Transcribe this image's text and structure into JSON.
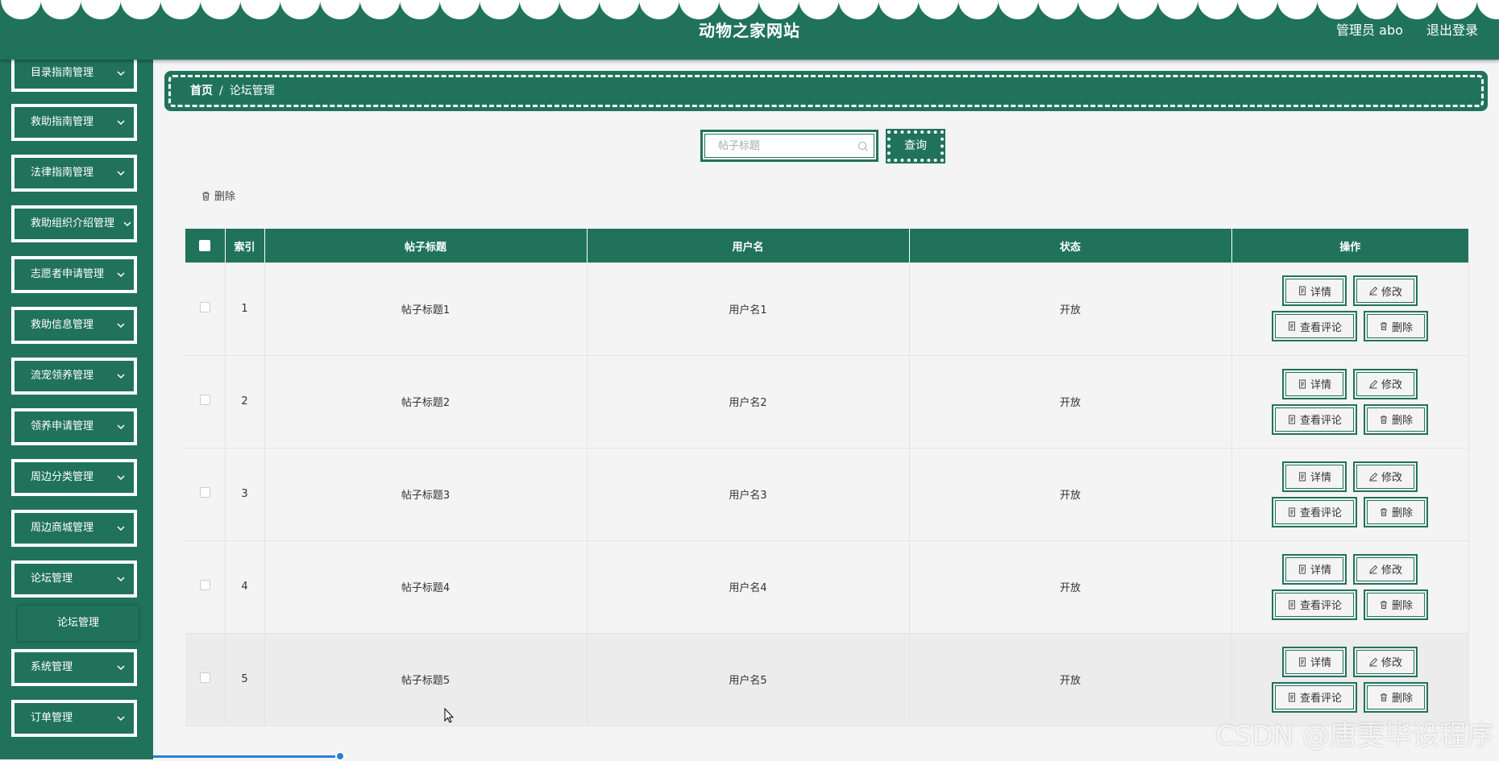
{
  "header": {
    "site_title": "动物之家网站",
    "admin_label": "管理员 abo",
    "logout_label": "退出登录"
  },
  "sidebar": {
    "items": [
      {
        "label": "目录指南管理"
      },
      {
        "label": "救助指南管理"
      },
      {
        "label": "法律指南管理"
      },
      {
        "label": "救助组织介绍管理"
      },
      {
        "label": "志愿者申请管理"
      },
      {
        "label": "救助信息管理"
      },
      {
        "label": "流宠领养管理"
      },
      {
        "label": "领养申请管理"
      },
      {
        "label": "周边分类管理"
      },
      {
        "label": "周边商城管理"
      },
      {
        "label": "论坛管理"
      }
    ],
    "active_sub": "论坛管理",
    "after_items": [
      {
        "label": "系统管理"
      },
      {
        "label": "订单管理"
      }
    ]
  },
  "breadcrumb": {
    "home": "首页",
    "separator": "/",
    "current": "论坛管理"
  },
  "search": {
    "placeholder": "帖子标题",
    "button": "查询"
  },
  "toolbar": {
    "delete_label": "删除"
  },
  "table": {
    "columns": [
      "索引",
      "帖子标题",
      "用户名",
      "状态",
      "操作"
    ],
    "rows": [
      {
        "index": "1",
        "title": "帖子标题1",
        "user": "用户名1",
        "status": "开放"
      },
      {
        "index": "2",
        "title": "帖子标题2",
        "user": "用户名2",
        "status": "开放"
      },
      {
        "index": "3",
        "title": "帖子标题3",
        "user": "用户名3",
        "status": "开放"
      },
      {
        "index": "4",
        "title": "帖子标题4",
        "user": "用户名4",
        "status": "开放"
      },
      {
        "index": "5",
        "title": "帖子标题5",
        "user": "用户名5",
        "status": "开放"
      }
    ],
    "actions": {
      "detail": "详情",
      "edit": "修改",
      "comments": "查看评论",
      "delete": "删除"
    }
  },
  "watermark": "CSDN @唐雯毕设程序",
  "colors": {
    "primary": "#20735a",
    "background": "#f4f4f4"
  }
}
